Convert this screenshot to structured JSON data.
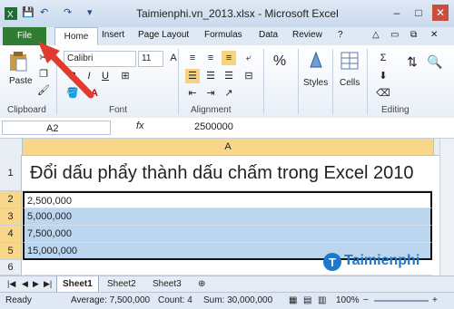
{
  "window": {
    "title": "Taimienphi.vn_2013.xlsx - Microsoft Excel",
    "controls": [
      "–",
      "□",
      "✕"
    ]
  },
  "ribbon_tabs": [
    "File",
    "Home",
    "Insert",
    "Page Layout",
    "Formulas",
    "Data",
    "Review"
  ],
  "ribbon": {
    "paste_label": "Paste",
    "font_name": "Calibri",
    "font_size": "11",
    "styles_label": "Styles",
    "cells_label": "Cells",
    "groups": [
      "Clipboard",
      "Font",
      "Alignment",
      "Editing"
    ]
  },
  "formula_bar": {
    "name_box": "A2",
    "fx": "fx",
    "value": "2500000"
  },
  "grid": {
    "column_header": "A",
    "rows": [
      {
        "num": "1",
        "value": "Đổi dấu phẩy thành dấu chấm trong Excel 2010"
      },
      {
        "num": "2",
        "value": "2,500,000"
      },
      {
        "num": "3",
        "value": "5,000,000"
      },
      {
        "num": "4",
        "value": "7,500,000"
      },
      {
        "num": "5",
        "value": "15,000,000"
      },
      {
        "num": "6",
        "value": ""
      }
    ]
  },
  "sheets": [
    "Sheet1",
    "Sheet2",
    "Sheet3"
  ],
  "status": {
    "ready": "Ready",
    "average": "Average: 7,500,000",
    "count": "Count: 4",
    "sum": "Sum: 30,000,000",
    "zoom": "100%"
  },
  "watermark": "Taimienphi"
}
